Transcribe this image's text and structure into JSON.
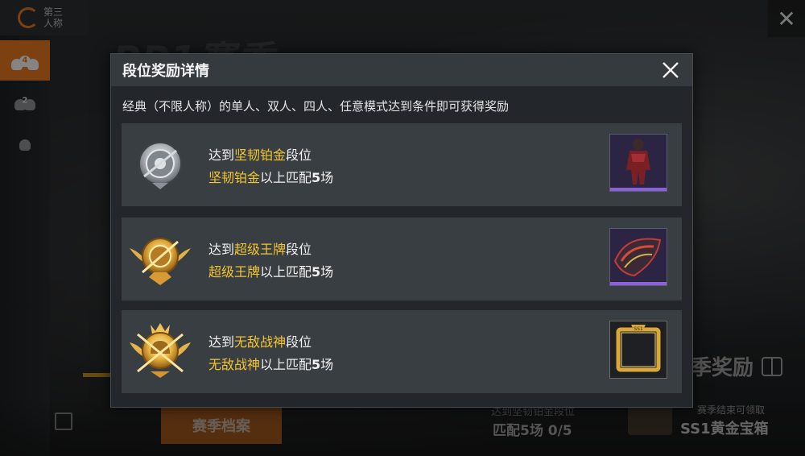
{
  "background": {
    "mode_switch_label": "第三\n人称",
    "squad_tabs": [
      {
        "name": "squad",
        "number": "4",
        "active": true
      },
      {
        "name": "duo",
        "number": "2",
        "active": false
      },
      {
        "name": "solo",
        "number": "",
        "active": false
      }
    ],
    "logo_text": "PP1赛季",
    "season_reward_label": "季奖励",
    "season_file_button": "赛季档案",
    "progress_title": "达到坚韧铂金段位",
    "progress_value": "匹配5场 0/5",
    "chest_hint": "赛季结束可领取",
    "chest_name": "SS1黄金宝箱"
  },
  "dialog": {
    "title": "段位奖励详情",
    "subtitle": "经典（不限人称）的单人、双人、四人、任意模式达到条件即可获得奖励",
    "rows": [
      {
        "prefix": "达到",
        "rank": "坚韧铂金",
        "suffix": "段位",
        "req_rank": "坚韧铂金",
        "req_text": "以上匹配",
        "req_count": "5",
        "req_unit": "场",
        "badge": "platinum-badge-icon",
        "reward": "outfit-icon"
      },
      {
        "prefix": "达到",
        "rank": "超级王牌",
        "suffix": "段位",
        "req_rank": "超级王牌",
        "req_text": "以上匹配",
        "req_count": "5",
        "req_unit": "场",
        "badge": "ace-badge-icon",
        "reward": "parachute-icon"
      },
      {
        "prefix": "达到",
        "rank": "无敌战神",
        "suffix": "段位",
        "req_rank": "无敌战神",
        "req_text": "以上匹配",
        "req_count": "5",
        "req_unit": "场",
        "badge": "conqueror-badge-icon",
        "reward": "avatar-frame-icon"
      }
    ]
  },
  "colors": {
    "highlight": "#f2c631",
    "accent_orange": "#e3761e",
    "rarity_purple": "#8a62d6"
  }
}
